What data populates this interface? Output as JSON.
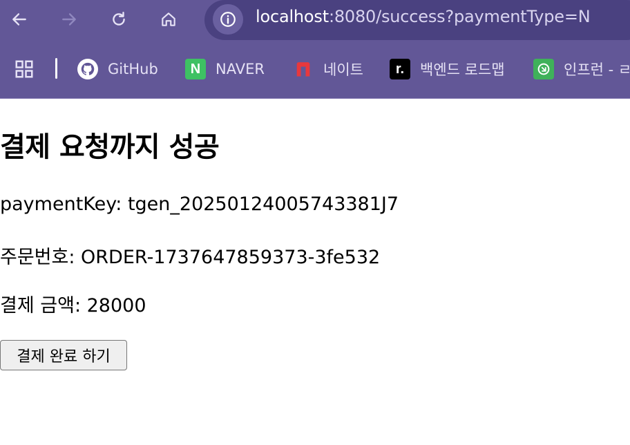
{
  "browser": {
    "url_host": "localhost",
    "url_rest": ":8080/success?paymentType=N",
    "bookmarks": [
      {
        "label": "GitHub",
        "icon": "github-icon"
      },
      {
        "label": "NAVER",
        "icon": "naver-icon"
      },
      {
        "label": "네이트",
        "icon": "nate-icon"
      },
      {
        "label": "백엔드 로드맵",
        "icon": "roadmap-icon"
      },
      {
        "label": "인프런 - ㄹ",
        "icon": "inflearn-icon"
      }
    ],
    "colors": {
      "frame": "#625797",
      "omnibox": "#4a4180"
    }
  },
  "page": {
    "title": "결제 요청까지 성공",
    "payment_key_line": "paymentKey: tgen_20250124005743381J7",
    "order_line": "주문번호: ORDER-1737647859373-3fe532",
    "amount_line": "결제 금액: 28000",
    "complete_button": "결제 완료 하기"
  }
}
